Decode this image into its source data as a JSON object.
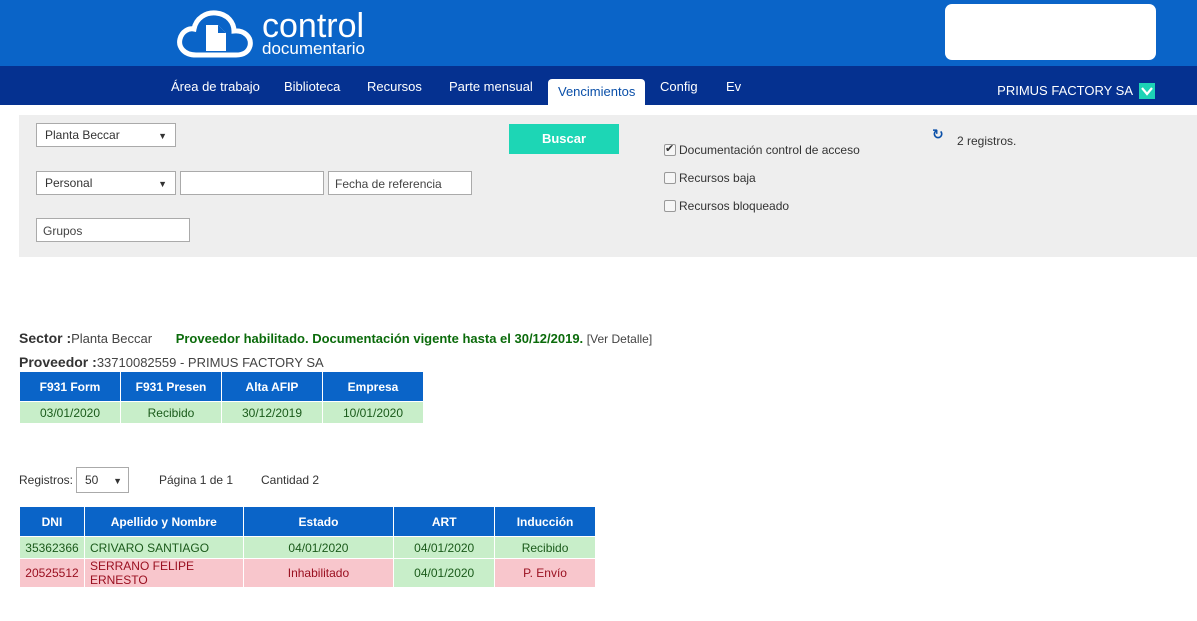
{
  "brand": {
    "title": "control",
    "subtitle": "documentario"
  },
  "nav": {
    "items": [
      "Área de trabajo",
      "Biblioteca",
      "Recursos",
      "Parte mensual",
      "Vencimientos",
      "Config",
      "Ev"
    ],
    "active": "Vencimientos",
    "company": "PRIMUS FACTORY SA"
  },
  "filters": {
    "planta": "Planta Beccar",
    "tipo": "Personal",
    "text_value": "",
    "fecha_placeholder": "Fecha de referencia",
    "grupos_placeholder": "Grupos",
    "buscar_label": "Buscar",
    "checkboxes": [
      {
        "label": "Documentación control de acceso",
        "checked": true
      },
      {
        "label": "Recursos baja",
        "checked": false
      },
      {
        "label": "Recursos bloqueado",
        "checked": false
      }
    ],
    "count_text": "2 registros."
  },
  "sector": {
    "label": "Sector :",
    "value": "Planta Beccar",
    "status": "Proveedor habilitado. Documentación vigente hasta el 30/12/2019.",
    "detail_link": "[Ver Detalle]"
  },
  "provider": {
    "label": "Proveedor :",
    "value": "33710082559 - PRIMUS FACTORY SA"
  },
  "provider_table": {
    "headers": [
      "F931 Form",
      "F931 Presen",
      "Alta AFIP",
      "Empresa"
    ],
    "row": [
      "03/01/2020",
      "Recibido",
      "30/12/2019",
      "10/01/2020"
    ]
  },
  "pager": {
    "label": "Registros:",
    "page_size": "50",
    "pagina": "Página 1 de 1",
    "cantidad": "Cantidad 2"
  },
  "people_table": {
    "headers": [
      "DNI",
      "Apellido y Nombre",
      "Estado",
      "ART",
      "Inducción"
    ],
    "rows": [
      [
        "35362366",
        "CRIVARO SANTIAGO",
        "04/01/2020",
        "04/01/2020",
        "Recibido"
      ],
      [
        "20525512",
        "SERRANO FELIPE ERNESTO",
        "Inhabilitado",
        "04/01/2020",
        "P. Envío"
      ]
    ]
  },
  "colors": {
    "header_blue": "#0a64c8",
    "nav_dark_blue": "#053190",
    "accent_teal": "#1dd6b5",
    "ok_green": "#c8eec9",
    "bad_red": "#f8c6cc"
  }
}
